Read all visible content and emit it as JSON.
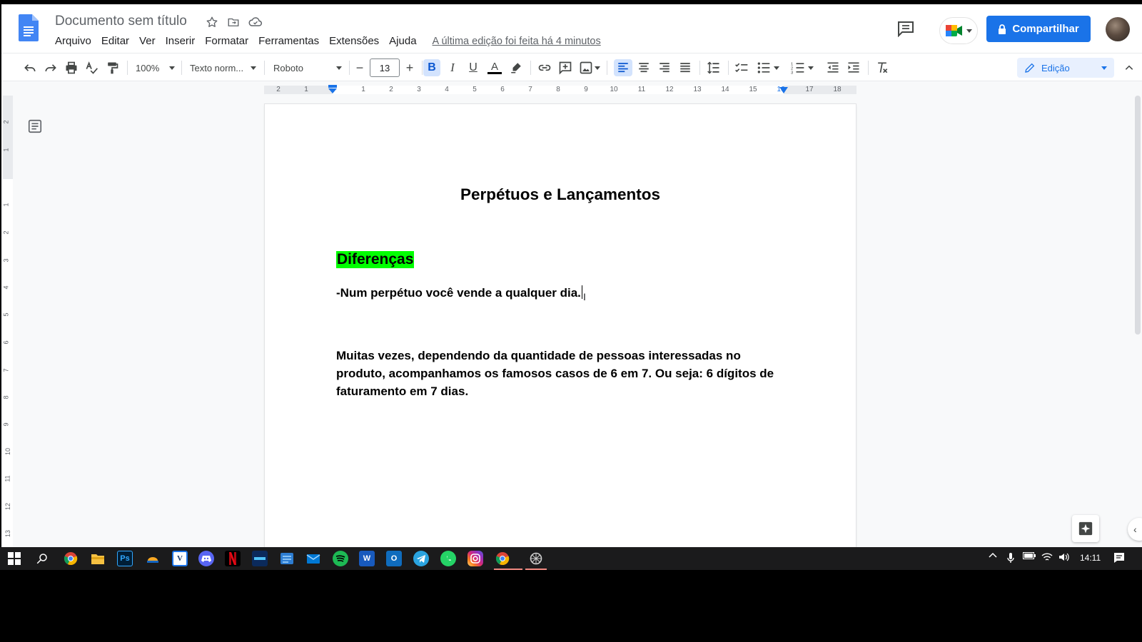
{
  "header": {
    "doc_title": "Documento sem título",
    "menu": [
      "Arquivo",
      "Editar",
      "Ver",
      "Inserir",
      "Formatar",
      "Ferramentas",
      "Extensões",
      "Ajuda"
    ],
    "last_edit": "A última edição foi feita há 4 minutos",
    "share_label": "Compartilhar"
  },
  "toolbar": {
    "zoom": "100%",
    "style": "Texto norm...",
    "font": "Roboto",
    "font_size": "13",
    "mode": "Edição",
    "icons": [
      "undo-icon",
      "redo-icon",
      "print-icon",
      "spellcheck-icon",
      "paint-format-icon",
      "decrease-font-icon",
      "increase-font-icon",
      "bold-icon",
      "italic-icon",
      "underline-icon",
      "text-color-icon",
      "highlight-icon",
      "link-icon",
      "add-comment-icon",
      "insert-image-icon",
      "align-left-icon",
      "align-center-icon",
      "align-right-icon",
      "justify-icon",
      "line-spacing-icon",
      "checklist-icon",
      "bulleted-list-icon",
      "numbered-list-icon",
      "decrease-indent-icon",
      "increase-indent-icon",
      "clear-formatting-icon",
      "pencil-icon",
      "collapse-icon"
    ]
  },
  "ruler": {
    "h_numbers": [
      "2",
      "1",
      "1",
      "2",
      "3",
      "4",
      "5",
      "6",
      "7",
      "8",
      "9",
      "10",
      "11",
      "12",
      "13",
      "14",
      "15",
      "16",
      "17",
      "18"
    ],
    "v_numbers": [
      "2",
      "1",
      "1",
      "2",
      "3",
      "4",
      "5",
      "6",
      "7",
      "8",
      "9",
      "10",
      "11",
      "12",
      "13"
    ]
  },
  "document": {
    "heading": "Perpétuos e Lançamentos",
    "subheading": "Diferenças",
    "subheading_highlight": "#00ff00",
    "line1": "-Num perpétuo você vende a qualquer dia.",
    "paragraph": "Muitas vezes, dependendo da quantidade de pessoas interessadas no produto, acompanhamos os famosos casos de 6 em 7. Ou seja: 6 dígitos de faturamento em 7 dias."
  },
  "colors": {
    "accent": "#1a73e8",
    "highlight": "#00ff00",
    "taskbar": "#1b1b1c"
  },
  "taskbar": {
    "apps": [
      "windows-start-icon",
      "search-icon",
      "chrome-icon",
      "file-explorer-icon",
      "photoshop-icon",
      "app-icon",
      "vegas-icon",
      "discord-icon",
      "netflix-icon",
      "app-icon",
      "app-icon",
      "mail-icon",
      "spotify-icon",
      "word-icon",
      "outlook-icon",
      "telegram-icon",
      "whatsapp-icon",
      "instagram-icon",
      "chrome-icon",
      "app-icon"
    ],
    "ps_label": "Ps",
    "v_label": "V",
    "w_label": "W",
    "o_label": "O",
    "clock": "14:11"
  }
}
